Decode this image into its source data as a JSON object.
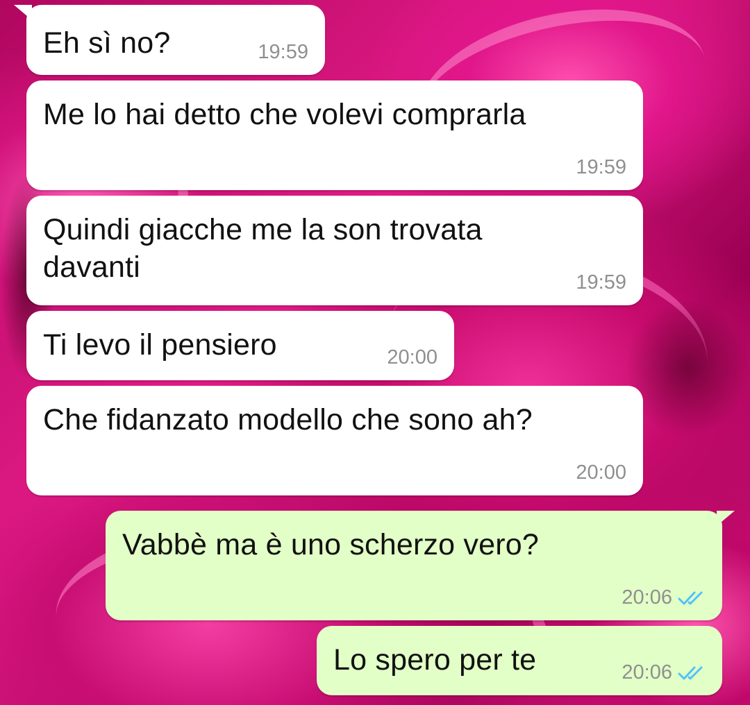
{
  "messages": [
    {
      "direction": "in",
      "text": "Eh sì no?",
      "time": "19:59"
    },
    {
      "direction": "in",
      "text": "Me lo hai detto che volevi comprarla",
      "time": "19:59"
    },
    {
      "direction": "in",
      "text": "Quindi giacche me la son trovata\ndavanti",
      "time": "19:59"
    },
    {
      "direction": "in",
      "text": "Ti levo il pensiero",
      "time": "20:00"
    },
    {
      "direction": "in",
      "text": "Che fidanzato modello che sono ah?",
      "time": "20:00"
    },
    {
      "direction": "out",
      "text": "Vabbè ma è uno scherzo vero?",
      "time": "20:06",
      "status": "read"
    },
    {
      "direction": "out",
      "text": "Lo spero per te",
      "time": "20:06",
      "status": "read"
    }
  ],
  "colors": {
    "incoming_bubble": "#ffffff",
    "outgoing_bubble": "#e2ffc7",
    "read_tick": "#4fc3f7",
    "timestamp": "#8f8f8f",
    "wallpaper": "#d0106e"
  },
  "icons": {
    "read_status": "double-check-icon"
  }
}
